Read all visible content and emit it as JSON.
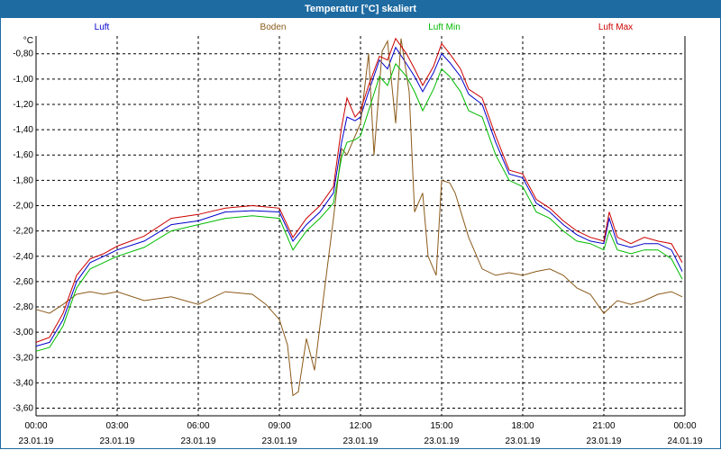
{
  "title": "Temperatur [°C] skaliert",
  "chart_data": {
    "type": "line",
    "ylabel": "°C",
    "ylim": [
      -3.66,
      -0.66
    ],
    "yticks": [
      "-0,80",
      "-1,00",
      "-1,20",
      "-1,40",
      "-1,60",
      "-1,80",
      "-2,00",
      "-2,20",
      "-2,40",
      "-2,60",
      "-2,80",
      "-3,00",
      "-3,20",
      "-3,40",
      "-3,60"
    ],
    "yvalues": [
      -0.8,
      -1.0,
      -1.2,
      -1.4,
      -1.6,
      -1.8,
      -2.0,
      -2.2,
      -2.4,
      -2.6,
      -2.8,
      -3.0,
      -3.2,
      -3.4,
      -3.6
    ],
    "xlim": [
      0,
      24
    ],
    "xticks": [
      {
        "time": "00:00",
        "date": "23.01.19"
      },
      {
        "time": "03:00",
        "date": "23.01.19"
      },
      {
        "time": "06:00",
        "date": "23.01.19"
      },
      {
        "time": "09:00",
        "date": "23.01.19"
      },
      {
        "time": "12:00",
        "date": "23.01.19"
      },
      {
        "time": "15:00",
        "date": "23.01.19"
      },
      {
        "time": "18:00",
        "date": "23.01.19"
      },
      {
        "time": "21:00",
        "date": "23.01.19"
      },
      {
        "time": "00:00",
        "date": "24.01.19"
      }
    ],
    "grid": true,
    "legend": "top",
    "series": [
      {
        "name": "Luft",
        "color": "#0000cc",
        "x": [
          0,
          0.5,
          1,
          1.5,
          2,
          2.5,
          3,
          4,
          5,
          6,
          7,
          8,
          9,
          9.5,
          10,
          10.5,
          11,
          11.3,
          11.5,
          11.8,
          12,
          12.3,
          12.7,
          13,
          13.3,
          13.7,
          14,
          14.3,
          14.7,
          15,
          15.3,
          15.7,
          16,
          16.5,
          17,
          17.5,
          18,
          18.5,
          19,
          19.5,
          20,
          20.5,
          21,
          21.2,
          21.5,
          22,
          22.5,
          23,
          23.5,
          23.9
        ],
        "y": [
          -3.11,
          -3.08,
          -2.9,
          -2.6,
          -2.45,
          -2.4,
          -2.35,
          -2.28,
          -2.15,
          -2.12,
          -2.05,
          -2.04,
          -2.05,
          -2.28,
          -2.15,
          -2.05,
          -1.9,
          -1.5,
          -1.3,
          -1.33,
          -1.3,
          -1.1,
          -0.85,
          -0.92,
          -0.75,
          -0.88,
          -0.98,
          -1.1,
          -0.95,
          -0.8,
          -0.87,
          -0.98,
          -1.12,
          -1.2,
          -1.5,
          -1.75,
          -1.78,
          -1.98,
          -2.05,
          -2.15,
          -2.23,
          -2.28,
          -2.3,
          -2.1,
          -2.3,
          -2.33,
          -2.3,
          -2.3,
          -2.35,
          -2.52
        ]
      },
      {
        "name": "Boden",
        "color": "#8b5a1a",
        "x": [
          0,
          0.5,
          1,
          1.5,
          2,
          2.5,
          3,
          4,
          5,
          6,
          7,
          8,
          8.5,
          9,
          9.3,
          9.5,
          9.7,
          10,
          10.3,
          10.5,
          11,
          11.3,
          11.5,
          12,
          12.3,
          12.5,
          12.8,
          13,
          13.3,
          13.5,
          13.8,
          14,
          14.3,
          14.5,
          14.8,
          15,
          15.3,
          15.5,
          16,
          16.5,
          17,
          17.5,
          18,
          18.5,
          19,
          19.5,
          20,
          20.5,
          21,
          21.5,
          22,
          22.5,
          23,
          23.5,
          23.9
        ],
        "y": [
          -2.82,
          -2.85,
          -2.78,
          -2.7,
          -2.68,
          -2.7,
          -2.68,
          -2.75,
          -2.72,
          -2.78,
          -2.68,
          -2.7,
          -2.78,
          -2.9,
          -3.1,
          -3.5,
          -3.47,
          -3.05,
          -3.3,
          -2.95,
          -2.1,
          -1.55,
          -1.6,
          -1.35,
          -0.8,
          -1.6,
          -0.78,
          -0.7,
          -1.35,
          -0.68,
          -1.1,
          -2.05,
          -1.9,
          -2.4,
          -2.55,
          -1.8,
          -1.82,
          -1.9,
          -2.25,
          -2.5,
          -2.55,
          -2.53,
          -2.55,
          -2.52,
          -2.5,
          -2.55,
          -2.65,
          -2.7,
          -2.85,
          -2.75,
          -2.78,
          -2.75,
          -2.7,
          -2.68,
          -2.72
        ]
      },
      {
        "name": "Luft Min",
        "color": "#00bb00",
        "x": [
          0,
          0.5,
          1,
          1.5,
          2,
          2.5,
          3,
          4,
          5,
          6,
          7,
          8,
          9,
          9.5,
          10,
          10.5,
          11,
          11.3,
          11.5,
          11.8,
          12,
          12.3,
          12.7,
          13,
          13.3,
          13.7,
          14,
          14.3,
          14.7,
          15,
          15.3,
          15.7,
          16,
          16.5,
          17,
          17.5,
          18,
          18.5,
          19,
          19.5,
          20,
          20.5,
          21,
          21.2,
          21.5,
          22,
          22.5,
          23,
          23.5,
          23.9
        ],
        "y": [
          -3.15,
          -3.12,
          -2.95,
          -2.65,
          -2.5,
          -2.45,
          -2.4,
          -2.33,
          -2.2,
          -2.15,
          -2.1,
          -2.08,
          -2.1,
          -2.35,
          -2.2,
          -2.1,
          -1.98,
          -1.62,
          -1.5,
          -1.48,
          -1.45,
          -1.25,
          -0.98,
          -1.05,
          -0.88,
          -0.98,
          -1.1,
          -1.25,
          -1.08,
          -0.92,
          -0.98,
          -1.1,
          -1.25,
          -1.3,
          -1.6,
          -1.8,
          -1.85,
          -2.05,
          -2.1,
          -2.2,
          -2.28,
          -2.3,
          -2.35,
          -2.2,
          -2.35,
          -2.38,
          -2.35,
          -2.35,
          -2.42,
          -2.58
        ]
      },
      {
        "name": "Luft Max",
        "color": "#cc0000",
        "x": [
          0,
          0.5,
          1,
          1.5,
          2,
          2.5,
          3,
          4,
          5,
          6,
          7,
          8,
          9,
          9.5,
          10,
          10.5,
          11,
          11.3,
          11.5,
          11.8,
          12,
          12.3,
          12.7,
          13,
          13.3,
          13.7,
          14,
          14.3,
          14.7,
          15,
          15.3,
          15.7,
          16,
          16.5,
          17,
          17.5,
          18,
          18.5,
          19,
          19.5,
          20,
          20.5,
          21,
          21.2,
          21.5,
          22,
          22.5,
          23,
          23.5,
          23.9
        ],
        "y": [
          -3.08,
          -3.04,
          -2.85,
          -2.55,
          -2.42,
          -2.38,
          -2.32,
          -2.24,
          -2.1,
          -2.07,
          -2.02,
          -2.0,
          -2.02,
          -2.25,
          -2.1,
          -2.0,
          -1.85,
          -1.38,
          -1.15,
          -1.3,
          -1.25,
          -1.05,
          -0.82,
          -0.85,
          -0.68,
          -0.8,
          -0.92,
          -1.05,
          -0.9,
          -0.72,
          -0.8,
          -0.92,
          -1.08,
          -1.15,
          -1.45,
          -1.72,
          -1.75,
          -1.95,
          -2.02,
          -2.12,
          -2.2,
          -2.25,
          -2.28,
          -2.05,
          -2.25,
          -2.3,
          -2.25,
          -2.28,
          -2.3,
          -2.45
        ]
      }
    ]
  }
}
